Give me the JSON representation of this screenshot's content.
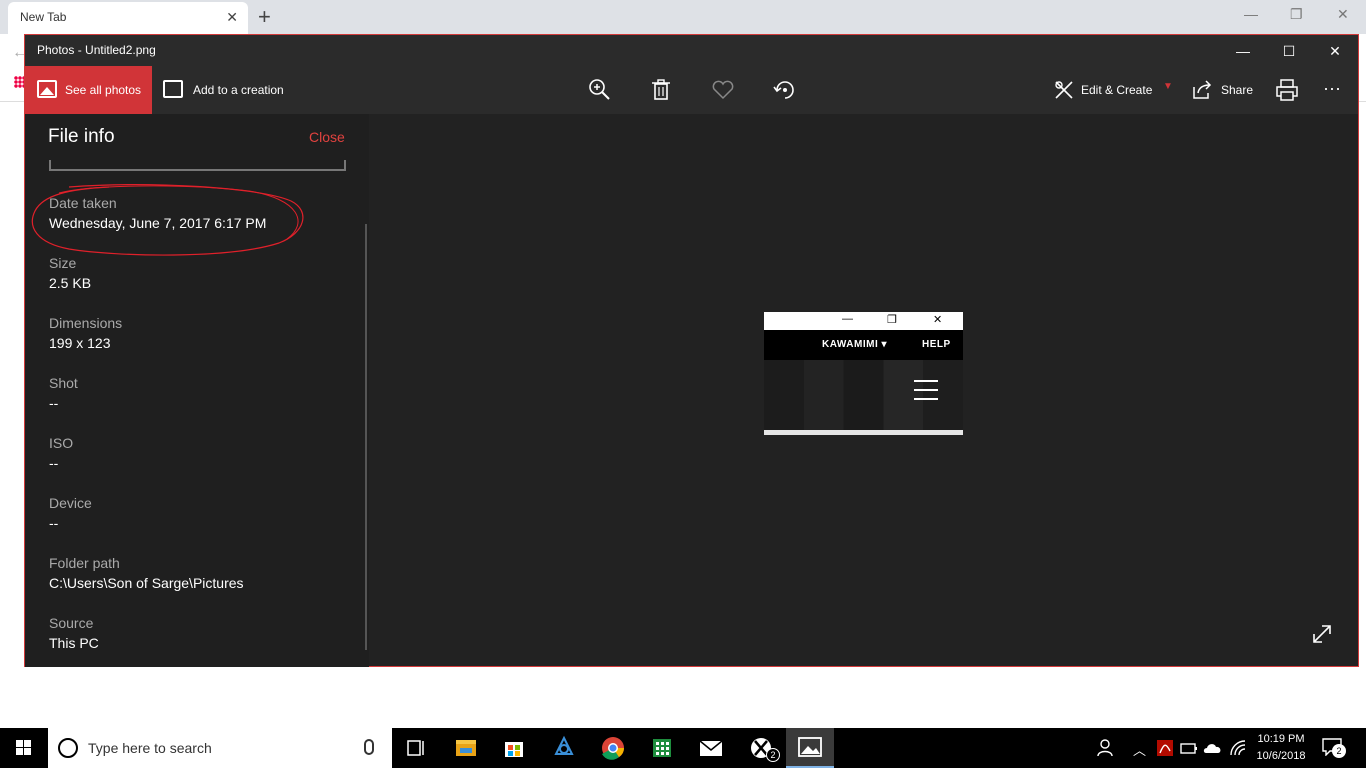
{
  "browser": {
    "tab_title": "New Tab",
    "tab_close": "✕",
    "new_tab": "+"
  },
  "window": {
    "title": "Photos - Untitled2.png"
  },
  "commandbar": {
    "see_all": "See all photos",
    "add_creation": "Add to a creation",
    "edit_create": "Edit & Create",
    "share": "Share",
    "more": "···"
  },
  "file_info": {
    "title": "File info",
    "close": "Close",
    "fields": [
      {
        "label": "Date taken",
        "value": "Wednesday, June 7, 2017 6:17 PM"
      },
      {
        "label": "Size",
        "value": "2.5 KB"
      },
      {
        "label": "Dimensions",
        "value": "199 x 123"
      },
      {
        "label": "Shot",
        "value": "--"
      },
      {
        "label": "ISO",
        "value": "--"
      },
      {
        "label": "Device",
        "value": "--"
      },
      {
        "label": "Folder path",
        "value": "C:\\Users\\Son of Sarge\\Pictures"
      },
      {
        "label": "Source",
        "value": "This PC"
      }
    ]
  },
  "preview": {
    "nav_left": "KAWAMIMI ▾",
    "nav_right": "HELP"
  },
  "taskbar": {
    "search_placeholder": "Type here to search",
    "time": "10:19 PM",
    "date": "10/6/2018",
    "xbox_badge": "2",
    "notification_count": "2"
  },
  "colors": {
    "accent": "#d13438",
    "panel_bg": "#1f1f1f",
    "window_bg": "#222222",
    "annotation": "#e0202a"
  }
}
